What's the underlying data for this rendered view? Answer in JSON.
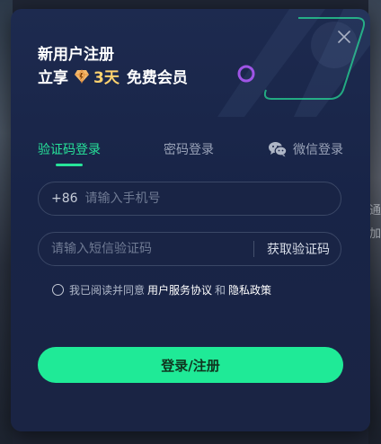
{
  "modal": {
    "title_line1": "新用户注册",
    "title_line2_prefix": "立享",
    "title_line2_days": "3天",
    "title_line2_suffix": "免费会员"
  },
  "tabs": [
    {
      "label": "验证码登录",
      "active": true
    },
    {
      "label": "密码登录",
      "active": false
    },
    {
      "label": "微信登录",
      "active": false
    }
  ],
  "phone": {
    "country_code": "+86",
    "placeholder": "请输入手机号",
    "value": ""
  },
  "sms": {
    "placeholder": "请输入短信验证码",
    "value": "",
    "get_code_label": "获取验证码"
  },
  "agreement": {
    "prefix": "我已阅读并同意",
    "terms": "用户服务协议",
    "conjunction": "和",
    "privacy": "隐私政策",
    "checked": false
  },
  "submit_label": "登录/注册",
  "background_glyphs": [
    "通",
    "加"
  ],
  "colors": {
    "accent": "#27e39a",
    "button": "#1fea97",
    "gold": "#ffd36e",
    "modal_bg": "#1b2648"
  }
}
